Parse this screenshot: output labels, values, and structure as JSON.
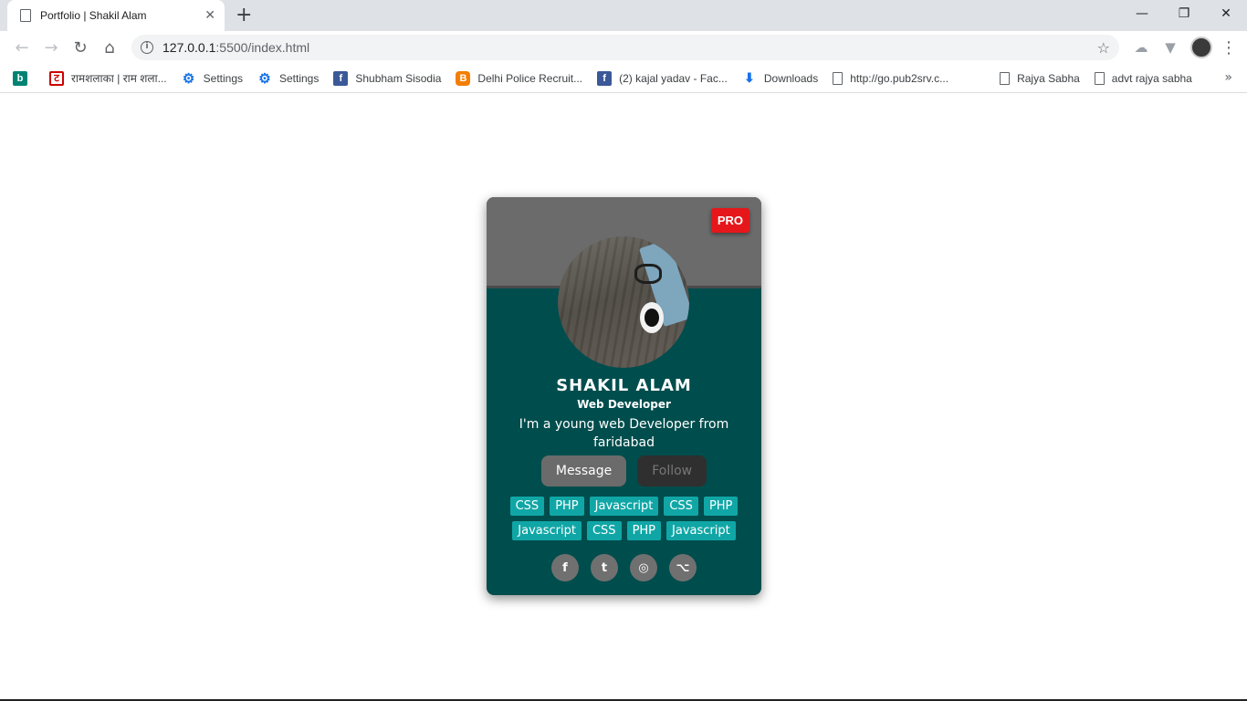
{
  "browser": {
    "tab_title": "Portfolio | Shakil Alam",
    "tab_close": "✕",
    "new_tab": "+",
    "window_controls": {
      "minimize": "—",
      "maximize": "❐",
      "close": "✕"
    },
    "nav": {
      "back": "←",
      "forward": "→",
      "reload": "↻",
      "home": "⌂"
    },
    "url_host": "127.0.0.1",
    "url_path": ":5500/index.html",
    "info_icon": "i",
    "star_icon": "☆",
    "menu_icon": "⋮",
    "extensions": [
      "☁",
      "▼"
    ]
  },
  "bookmarks": [
    {
      "icon": "bing-icon",
      "glyph": "b",
      "label": ""
    },
    {
      "icon": "ram-icon",
      "glyph": "ट",
      "label": "रामशलाका | राम शला..."
    },
    {
      "icon": "gear-icon",
      "glyph": "⚙",
      "label": "Settings"
    },
    {
      "icon": "gear-icon",
      "glyph": "⚙",
      "label": "Settings"
    },
    {
      "icon": "facebook-icon",
      "glyph": "f",
      "label": "Shubham Sisodia"
    },
    {
      "icon": "blogger-icon",
      "glyph": "B",
      "label": "Delhi Police Recruit..."
    },
    {
      "icon": "facebook-icon",
      "glyph": "f",
      "label": "(2) kajal yadav - Fac..."
    },
    {
      "icon": "download-icon",
      "glyph": "⬇",
      "label": "Downloads"
    },
    {
      "icon": "page-icon",
      "glyph": "",
      "label": "http://go.pub2srv.c..."
    },
    {
      "icon": "page-icon",
      "glyph": "",
      "label": "Rajya Sabha"
    },
    {
      "icon": "page-icon",
      "glyph": "",
      "label": "advt rajya sabha"
    }
  ],
  "bookmarks_more": "»",
  "card": {
    "badge": "PRO",
    "name": "SHAKIL ALAM",
    "role": "Web Developer",
    "bio": "I'm a young web Developer from faridabad",
    "message_button": "Message",
    "follow_button": "Follow",
    "skills": [
      "CSS",
      "PHP",
      "Javascript",
      "CSS",
      "PHP",
      "Javascript",
      "CSS",
      "PHP",
      "Javascript"
    ],
    "social": [
      {
        "icon": "facebook-icon",
        "glyph": "f"
      },
      {
        "icon": "twitter-icon",
        "glyph": "t"
      },
      {
        "icon": "instagram-icon",
        "glyph": "◎"
      },
      {
        "icon": "github-icon",
        "glyph": "⌥"
      }
    ],
    "colors": {
      "card_bg": "#004d4d",
      "header_bg": "#6b6b6b",
      "badge_bg": "#e6171b",
      "skill_bg": "#11a6a6"
    }
  }
}
